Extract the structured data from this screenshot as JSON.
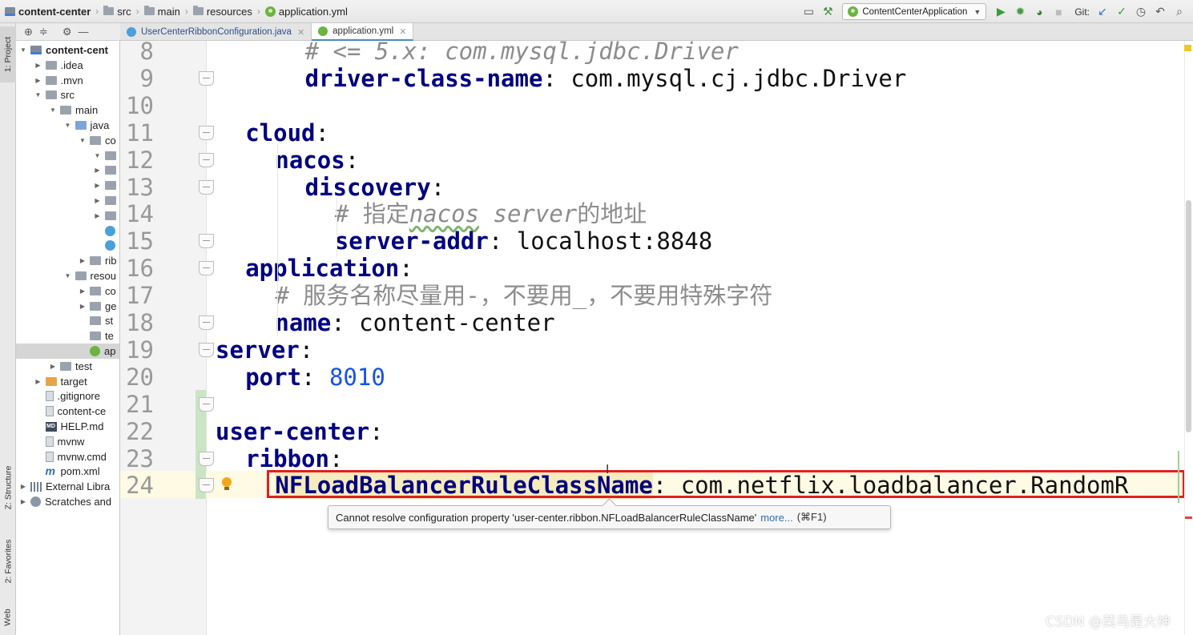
{
  "breadcrumbs": [
    {
      "label": "content-center",
      "icon": "module-icon"
    },
    {
      "label": "src",
      "icon": "folder-icon"
    },
    {
      "label": "main",
      "icon": "folder-icon"
    },
    {
      "label": "resources",
      "icon": "folder-icon"
    },
    {
      "label": "application.yml",
      "icon": "yml-file-icon"
    }
  ],
  "toolbar": {
    "run_config": "ContentCenterApplication",
    "git_label": "Git:"
  },
  "stripe": {
    "project": "1: Project",
    "structure": "Z: Structure",
    "favorites": "2: Favorites",
    "web": "Web"
  },
  "project_tree": [
    {
      "label": "content-cent",
      "depth": 0,
      "arrow": "down",
      "icon": "module",
      "bold": true
    },
    {
      "label": ".idea",
      "depth": 1,
      "arrow": "right",
      "icon": "folder"
    },
    {
      "label": ".mvn",
      "depth": 1,
      "arrow": "right",
      "icon": "folder"
    },
    {
      "label": "src",
      "depth": 1,
      "arrow": "down",
      "icon": "folder"
    },
    {
      "label": "main",
      "depth": 2,
      "arrow": "down",
      "icon": "folder"
    },
    {
      "label": "java",
      "depth": 3,
      "arrow": "down",
      "icon": "src"
    },
    {
      "label": "co",
      "depth": 4,
      "arrow": "down",
      "icon": "folder"
    },
    {
      "label": "",
      "depth": 5,
      "arrow": "down",
      "icon": "folder"
    },
    {
      "label": "",
      "depth": 5,
      "arrow": "right",
      "icon": "folder"
    },
    {
      "label": "",
      "depth": 5,
      "arrow": "right",
      "icon": "folder"
    },
    {
      "label": "",
      "depth": 5,
      "arrow": "right",
      "icon": "folder"
    },
    {
      "label": "",
      "depth": 5,
      "arrow": "right",
      "icon": "folder"
    },
    {
      "label": "",
      "depth": 5,
      "arrow": "",
      "icon": "class"
    },
    {
      "label": "",
      "depth": 5,
      "arrow": "",
      "icon": "class"
    },
    {
      "label": "rib",
      "depth": 4,
      "arrow": "right",
      "icon": "folder"
    },
    {
      "label": "resou",
      "depth": 3,
      "arrow": "down",
      "icon": "folder"
    },
    {
      "label": "co",
      "depth": 4,
      "arrow": "right",
      "icon": "folder"
    },
    {
      "label": "ge",
      "depth": 4,
      "arrow": "right",
      "icon": "folder"
    },
    {
      "label": "st",
      "depth": 4,
      "arrow": "",
      "icon": "folder"
    },
    {
      "label": "te",
      "depth": 4,
      "arrow": "",
      "icon": "folder"
    },
    {
      "label": "ap",
      "depth": 4,
      "arrow": "",
      "icon": "yml",
      "selected": true
    },
    {
      "label": "test",
      "depth": 2,
      "arrow": "right",
      "icon": "folder"
    },
    {
      "label": "target",
      "depth": 1,
      "arrow": "right",
      "icon": "excluded"
    },
    {
      "label": ".gitignore",
      "depth": 1,
      "arrow": "",
      "icon": "file"
    },
    {
      "label": "content-ce",
      "depth": 1,
      "arrow": "",
      "icon": "file"
    },
    {
      "label": "HELP.md",
      "depth": 1,
      "arrow": "",
      "icon": "md"
    },
    {
      "label": "mvnw",
      "depth": 1,
      "arrow": "",
      "icon": "file"
    },
    {
      "label": "mvnw.cmd",
      "depth": 1,
      "arrow": "",
      "icon": "file"
    },
    {
      "label": "pom.xml",
      "depth": 1,
      "arrow": "",
      "icon": "maven"
    },
    {
      "label": "External Libra",
      "depth": 0,
      "arrow": "right",
      "icon": "lib"
    },
    {
      "label": "Scratches and",
      "depth": 0,
      "arrow": "right",
      "icon": "scratch"
    }
  ],
  "tabs": [
    {
      "label": "UserCenterRibbonConfiguration.java",
      "icon_color": "#4aa0d8",
      "active": false
    },
    {
      "label": "application.yml",
      "icon_color": "#6cb33f",
      "active": true
    }
  ],
  "editor": {
    "lines": [
      {
        "no": "8",
        "indent": 3,
        "key": "",
        "sep": "",
        "value": "# <= 5.x: com.mysql.jdbc.Driver",
        "kind": "comment"
      },
      {
        "no": "9",
        "indent": 3,
        "key": "driver-class-name",
        "sep": ": ",
        "value": "com.mysql.cj.jdbc.Driver",
        "kind": "pair"
      },
      {
        "no": "10",
        "indent": 0,
        "key": "",
        "sep": "",
        "value": "",
        "kind": "blank"
      },
      {
        "no": "11",
        "indent": 1,
        "key": "cloud",
        "sep": ":",
        "value": "",
        "kind": "pair"
      },
      {
        "no": "12",
        "indent": 2,
        "key": "nacos",
        "sep": ":",
        "value": "",
        "kind": "pair"
      },
      {
        "no": "13",
        "indent": 3,
        "key": "discovery",
        "sep": ":",
        "value": "",
        "kind": "pair"
      },
      {
        "no": "14",
        "indent": 4,
        "key": "",
        "sep": "",
        "value": "# 指定nacos server的地址",
        "kind": "comment-nacos"
      },
      {
        "no": "15",
        "indent": 4,
        "key": "server-addr",
        "sep": ": ",
        "value": "localhost:8848",
        "kind": "pair"
      },
      {
        "no": "16",
        "indent": 1,
        "key": "application",
        "sep": ":",
        "value": "",
        "kind": "pair"
      },
      {
        "no": "17",
        "indent": 2,
        "key": "",
        "sep": "",
        "value": "# 服务名称尽量用-，不要用_，不要用特殊字符",
        "kind": "comment-zh"
      },
      {
        "no": "18",
        "indent": 2,
        "key": "name",
        "sep": ": ",
        "value": "content-center",
        "kind": "pair"
      },
      {
        "no": "19",
        "indent": 0,
        "key": "server",
        "sep": ":",
        "value": "",
        "kind": "pair"
      },
      {
        "no": "20",
        "indent": 1,
        "key": "port",
        "sep": ": ",
        "value": "8010",
        "kind": "number"
      },
      {
        "no": "21",
        "indent": 0,
        "key": "",
        "sep": "",
        "value": "",
        "kind": "blank"
      },
      {
        "no": "22",
        "indent": 0,
        "key": "user-center",
        "sep": ":",
        "value": "",
        "kind": "pair"
      },
      {
        "no": "23",
        "indent": 1,
        "key": "ribbon",
        "sep": ":",
        "value": "",
        "kind": "pair"
      },
      {
        "no": "24",
        "indent": 2,
        "key": "NFLoadBalancerRuleClassName",
        "sep": ": ",
        "value": "com.netflix.loadbalancer.RandomR",
        "kind": "warn"
      }
    ],
    "tooltip": {
      "message": "Cannot resolve configuration property 'user-center.ribbon.NFLoadBalancerRuleClassName'",
      "more": "more...",
      "shortcut": "(⌘F1)"
    }
  },
  "watermark": "CSDN @菜鸟是大神",
  "colors": {
    "keyword": "#000080",
    "comment": "#8c8c8c",
    "number": "#1750eb",
    "error_box": "#e0201f",
    "caret_line": "#fffae3"
  }
}
